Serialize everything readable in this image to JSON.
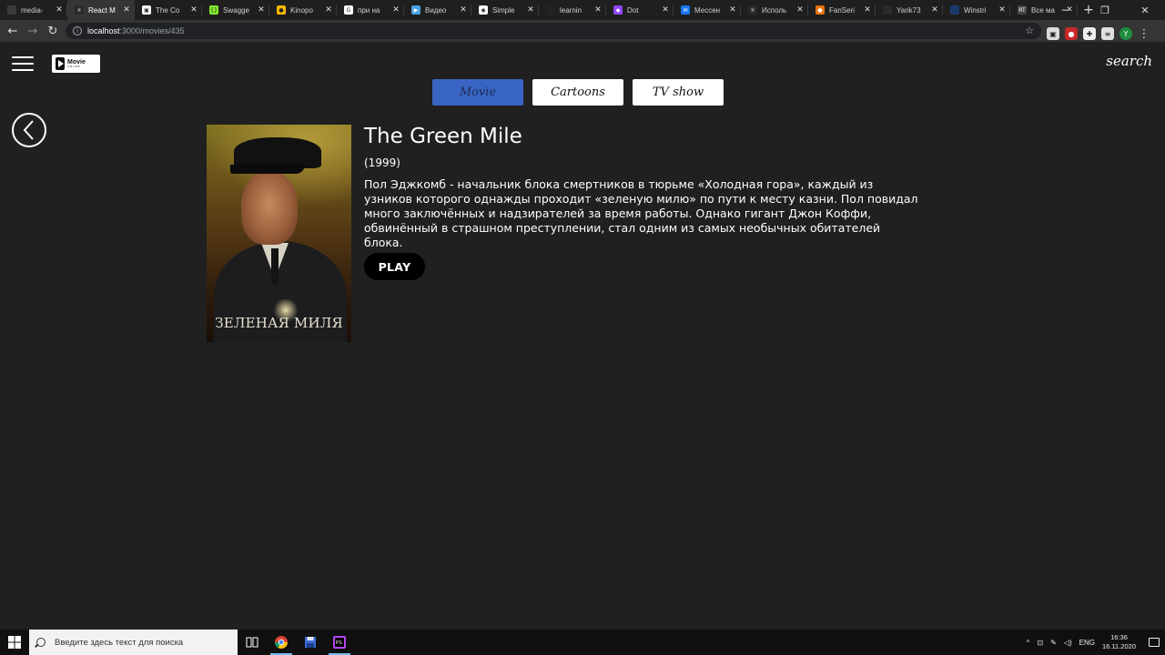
{
  "browser": {
    "tabs": [
      {
        "title": "media-",
        "fav_color": "#3a3a3a",
        "fav_glyph": ""
      },
      {
        "title": "React M",
        "fav_color": "#2a2a2a",
        "fav_glyph": "⚛",
        "active": true
      },
      {
        "title": "The Co",
        "fav_color": "#ffffff",
        "fav_glyph": "▣"
      },
      {
        "title": "Swagge",
        "fav_color": "#85ea2d",
        "fav_glyph": "{}"
      },
      {
        "title": "Kinopo",
        "fav_color": "#f5b800",
        "fav_glyph": "●"
      },
      {
        "title": "при на",
        "fav_color": "#ffffff",
        "fav_glyph": "G"
      },
      {
        "title": "Видео",
        "fav_color": "#4aa3df",
        "fav_glyph": "▶"
      },
      {
        "title": "Simple",
        "fav_color": "#ffffff",
        "fav_glyph": "◉"
      },
      {
        "title": "learnin",
        "fav_color": "#222222",
        "fav_glyph": ""
      },
      {
        "title": "Dot",
        "fav_color": "#9146ff",
        "fav_glyph": "◆"
      },
      {
        "title": "Мессен",
        "fav_color": "#1877f2",
        "fav_glyph": "✉"
      },
      {
        "title": "Исполь",
        "fav_color": "#2a2a2a",
        "fav_glyph": "⚛"
      },
      {
        "title": "FanSeri",
        "fav_color": "#e8730c",
        "fav_glyph": "●"
      },
      {
        "title": "Yarik73",
        "fav_color": "#2a2a2a",
        "fav_glyph": ""
      },
      {
        "title": "Winstri",
        "fav_color": "#1b3a6b",
        "fav_glyph": ""
      },
      {
        "title": "Все ма",
        "fav_color": "#444444",
        "fav_glyph": "RT"
      }
    ],
    "new_tab": "+",
    "window_controls": {
      "minimize": "─",
      "maximize": "❐",
      "close": "✕"
    },
    "url_host": "localhost",
    "url_path": ":3000/movies/435",
    "info_glyph": "i",
    "star_glyph": "☆",
    "profile_initial": "Y",
    "extensions": [
      {
        "color": "#dddddd",
        "glyph": "▣"
      },
      {
        "color": "#c62828",
        "glyph": "●"
      },
      {
        "color": "#eeeeee",
        "glyph": "✚"
      },
      {
        "color": "#e0e0e0",
        "glyph": "≡"
      }
    ]
  },
  "nav": {
    "logo_title": "Movie",
    "logo_subtitle": "ONLINE",
    "search_label": "search",
    "categories": [
      {
        "label": "Movie",
        "active": true
      },
      {
        "label": "Cartoons",
        "active": false
      },
      {
        "label": "TV show",
        "active": false
      }
    ]
  },
  "movie": {
    "title": "The Green Mile",
    "year": "(1999)",
    "description": "Пол Эджкомб - начальник блока смертников в тюрьме «Холодная гора», каждый из узников которого однажды проходит «зеленую милю» по пути к месту казни. Пол повидал много заключённых и надзирателей за время работы. Однако гигант Джон Коффи, обвинённый в страшном преступлении, стал одним из самых необычных обитателей блока.",
    "play_label": "PLAY",
    "poster_title": "ЗЕЛЕНАЯ МИЛЯ"
  },
  "taskbar": {
    "search_placeholder": "Введите здесь текст для поиска",
    "language": "ENG",
    "time": "16:36",
    "date": "16.11.2020",
    "accent": "#76b9ed"
  },
  "colors": {
    "page_bg": "#202020",
    "active_category": "#3865c4",
    "button_black": "#000000"
  }
}
